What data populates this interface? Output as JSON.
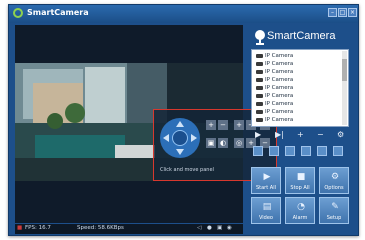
{
  "window": {
    "title": "SmartCamera"
  },
  "brand": {
    "name": "SmartCamera"
  },
  "camera_list": {
    "items": [
      "IP Camera",
      "IP Camera",
      "IP Camera",
      "IP Camera",
      "IP Camera",
      "IP Camera",
      "IP Camera",
      "IP Camera",
      "IP Camera"
    ]
  },
  "ptz": {
    "hint": "Click and move panel"
  },
  "status": {
    "fps": "FPS: 16.7",
    "speed": "Speed: 58.6KBps"
  },
  "controls": {
    "row": [
      "▶",
      "▶|",
      "+",
      "−",
      "⚙"
    ]
  },
  "tiles": [
    {
      "label": "Start All",
      "icon": "start-all-icon"
    },
    {
      "label": "Stop All",
      "icon": "stop-all-icon"
    },
    {
      "label": "Options",
      "icon": "options-icon"
    },
    {
      "label": "Video",
      "icon": "video-icon"
    },
    {
      "label": "Alarm",
      "icon": "alarm-icon"
    },
    {
      "label": "Setup",
      "icon": "setup-icon"
    }
  ],
  "colors": {
    "accent": "#1d4f8a",
    "ptz_border": "#d7382e",
    "tile": "#4f84be"
  }
}
